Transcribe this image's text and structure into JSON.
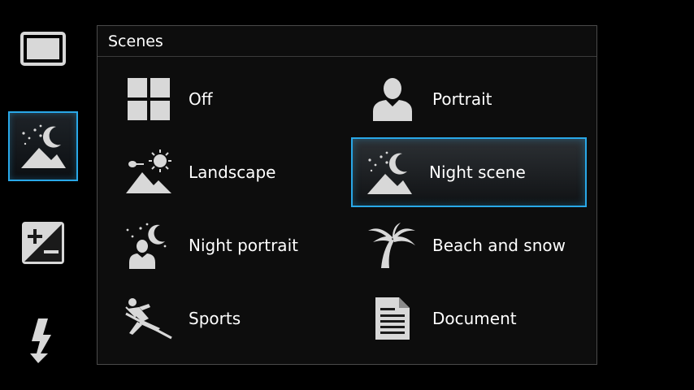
{
  "sidebar": {
    "items": [
      {
        "icon": "aspect-ratio-icon"
      },
      {
        "icon": "night-scene-icon",
        "selected": true
      },
      {
        "icon": "exposure-compensation-icon"
      },
      {
        "icon": "flash-icon"
      }
    ]
  },
  "scenes": {
    "title": "Scenes",
    "selected": "Night scene",
    "options": [
      {
        "label": "Off",
        "icon": "grid-off-icon"
      },
      {
        "label": "Portrait",
        "icon": "portrait-icon"
      },
      {
        "label": "Landscape",
        "icon": "landscape-icon"
      },
      {
        "label": "Night scene",
        "icon": "night-scene-icon"
      },
      {
        "label": "Night portrait",
        "icon": "night-portrait-icon"
      },
      {
        "label": "Beach and snow",
        "icon": "palm-tree-icon"
      },
      {
        "label": "Sports",
        "icon": "sports-icon"
      },
      {
        "label": "Document",
        "icon": "document-icon"
      }
    ]
  },
  "colors": {
    "accent": "#29a8e8",
    "icon": "#d8d8d8",
    "background": "#000000",
    "panel": "#0d0d0d"
  }
}
